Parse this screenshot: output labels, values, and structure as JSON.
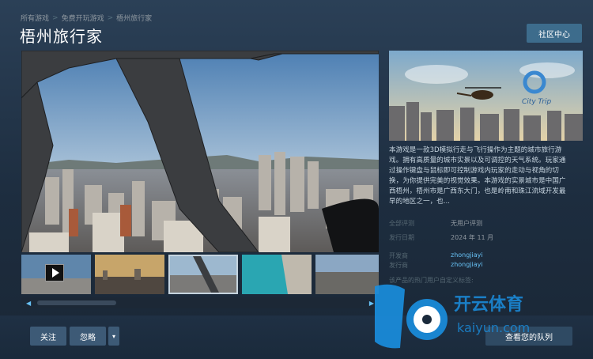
{
  "breadcrumb": {
    "item1": "所有游戏",
    "item2": "免费开玩游戏",
    "item3": "梧州旅行家",
    "separator": ">"
  },
  "page_title": "梧州旅行家",
  "community_button": "社区中心",
  "capsule": {
    "logo_text": "City Trip"
  },
  "description": "本游戏是一款3D模拟行走与飞行操作为主题的城市旅行游戏。拥有高质量的城市实景以及可调控的天气系统。玩家通过操作键盘与鼠标即可控制游戏内玩家的走动与视角的切换，为你提供完美的视觉效果。本游戏的实景城市是中国广西梧州，梧州市是广西东大门，也是岭南和珠江流域开发最早的地区之一，也...",
  "info": {
    "reviews_label": "全部评测",
    "reviews_value": "无用户评测",
    "release_label": "发行日期",
    "release_value": "2024 年 11 月",
    "developer_label": "开发商",
    "developer_value": "zhongjiayi",
    "publisher_label": "发行商",
    "publisher_value": "zhongjiayi"
  },
  "tags_label": "该产品的热门用户自定义标签:",
  "buttons": {
    "follow": "关注",
    "ignore": "忽略",
    "dropdown_icon": "chevron-down-icon",
    "view_queue": "查看您的队列"
  },
  "scroll": {
    "left_icon": "left-arrow-icon",
    "right_icon": "right-arrow-icon"
  },
  "watermark": {
    "text1": "开云体育",
    "text2": "kaiyun.com"
  }
}
